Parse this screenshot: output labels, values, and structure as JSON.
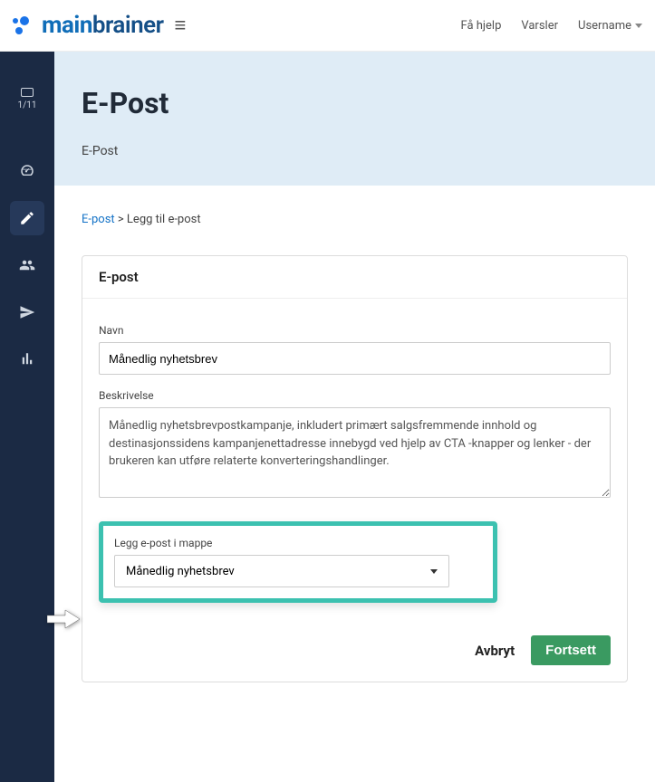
{
  "topbar": {
    "logo_main": "main",
    "logo_brainer": "brainer",
    "help_label": "Få hjelp",
    "alerts_label": "Varsler",
    "username_label": "Username"
  },
  "sidebar": {
    "step_indicator": "1/11"
  },
  "hero": {
    "title": "E-Post",
    "subtitle": "E-Post"
  },
  "breadcrumb": {
    "link_label": "E-post",
    "separator": " > ",
    "current": "Legg til e-post"
  },
  "panel": {
    "header": "E-post",
    "name_label": "Navn",
    "name_value": "Månedlig nyhetsbrev",
    "description_label": "Beskrivelse",
    "description_value": "Månedlig nyhetsbrevpostkampanje, inkludert primært salgsfremmende innhold og destinasjonssidens kampanjenettadresse innebygd ved hjelp av CTA -knapper og lenker - der brukeren kan utføre relaterte konverteringshandlinger.",
    "folder_label": "Legg e-post i mappe",
    "folder_value": "Månedlig nyhetsbrev",
    "cancel_label": "Avbryt",
    "continue_label": "Fortsett"
  }
}
